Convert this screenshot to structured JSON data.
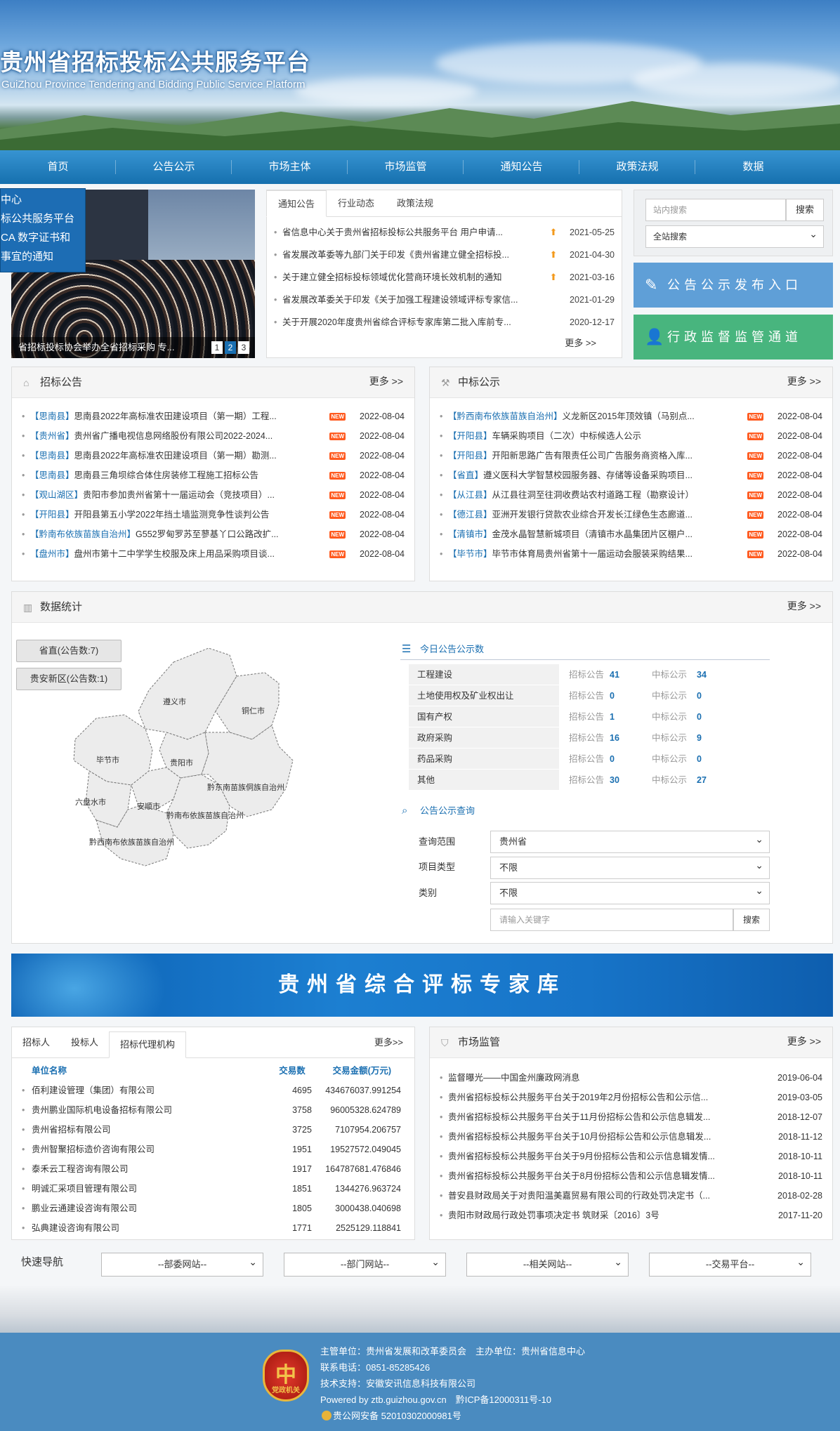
{
  "header": {
    "title": "贵州省招标投标公共服务平台",
    "subtitle": "GuiZhou Province Tendering and Bidding Public Service Platform"
  },
  "nav": [
    "首页",
    "公告公示",
    "市场主体",
    "市场监管",
    "通知公告",
    "政策法规",
    "数据"
  ],
  "float_notice": [
    "中心",
    "标公共服务平台",
    "CA 数字证书和",
    "事宜的通知"
  ],
  "banner": {
    "caption": "省招标投标协会举办全省招标采购 专...",
    "dots": [
      "1",
      "2",
      "3"
    ]
  },
  "notice": {
    "tabs": [
      "通知公告",
      "行业动态",
      "政策法规"
    ],
    "items": [
      {
        "t": "省信息中心关于贵州省招标投标公共服务平台 用户申请...",
        "d": "2021-05-25"
      },
      {
        "t": "省发展改革委等九部门关于印发《贵州省建立健全招标投...",
        "d": "2021-04-30"
      },
      {
        "t": "关于建立健全招标投标领域优化营商环境长效机制的通知",
        "d": "2021-03-16"
      },
      {
        "t": "省发展改革委关于印发《关于加强工程建设领域评标专家信...",
        "d": "2021-01-29"
      },
      {
        "t": "关于开展2020年度贵州省综合评标专家库第二批入库前专...",
        "d": "2020-12-17"
      }
    ],
    "more": "更多 >>"
  },
  "search": {
    "placeholder": "站内搜索",
    "button": "搜索",
    "scope": "全站搜索"
  },
  "buttons": {
    "publish": "公告公示发布入口",
    "supervise": "行政监督监管通道"
  },
  "bid": {
    "title": "招标公告",
    "more": "更多 >>",
    "new": "NEW",
    "items": [
      {
        "r": "【思南县】",
        "t": "思南县2022年高标准农田建设项目（第一期）工程...",
        "d": "2022-08-04"
      },
      {
        "r": "【贵州省】",
        "t": "贵州省广播电视信息网络股份有限公司2022-2024...",
        "d": "2022-08-04"
      },
      {
        "r": "【思南县】",
        "t": "思南县2022年高标准农田建设项目（第一期）勘测...",
        "d": "2022-08-04"
      },
      {
        "r": "【思南县】",
        "t": "思南县三角坝综合体住房装修工程施工招标公告",
        "d": "2022-08-04"
      },
      {
        "r": "【观山湖区】",
        "t": "贵阳市参加贵州省第十一届运动会（竞技项目）...",
        "d": "2022-08-04"
      },
      {
        "r": "【开阳县】",
        "t": "开阳县第五小学2022年挡土墙监测竞争性谈判公告",
        "d": "2022-08-04"
      },
      {
        "r": "【黔南布依族苗族自治州】",
        "t": "G552罗甸罗苏至蓼基丫口公路改扩...",
        "d": "2022-08-04"
      },
      {
        "r": "【盘州市】",
        "t": "盘州市第十二中学学生校服及床上用品采购项目谈...",
        "d": "2022-08-04"
      }
    ]
  },
  "win": {
    "title": "中标公示",
    "more": "更多 >>",
    "new": "NEW",
    "items": [
      {
        "r": "【黔西南布依族苗族自治州】",
        "t": "义龙新区2015年顶效镇（马别点...",
        "d": "2022-08-04"
      },
      {
        "r": "【开阳县】",
        "t": "车辆采购项目（二次）中标候选人公示",
        "d": "2022-08-04"
      },
      {
        "r": "【开阳县】",
        "t": "开阳新思路广告有限责任公司广告服务商资格入库...",
        "d": "2022-08-04"
      },
      {
        "r": "【省直】",
        "t": "遵义医科大学智慧校园服务器、存储等设备采购项目...",
        "d": "2022-08-04"
      },
      {
        "r": "【从江县】",
        "t": "从江县往洞至往洞收费站农村道路工程（勘察设计）",
        "d": "2022-08-04"
      },
      {
        "r": "【德江县】",
        "t": "亚洲开发银行贷款农业综合开发长江绿色生态廊道...",
        "d": "2022-08-04"
      },
      {
        "r": "【清镇市】",
        "t": "金茂水晶智慧新城项目（清镇市水晶集团片区棚户...",
        "d": "2022-08-04"
      },
      {
        "r": "【毕节市】",
        "t": "毕节市体育局贵州省第十一届运动会服装采购结果...",
        "d": "2022-08-04"
      }
    ]
  },
  "stats": {
    "title": "数据统计",
    "more": "更多 >>",
    "regions_btn": [
      "省直(公告数:7)",
      "贵安新区(公告数:1)"
    ],
    "map_labels": [
      "遵义市",
      "铜仁市",
      "毕节市",
      "贵阳市",
      "黔东南苗族侗族自治州",
      "六盘水市",
      "安顺市",
      "黔南布依族苗族自治州",
      "黔西南布依族苗族自治州"
    ],
    "today_title": "今日公告公示数",
    "label_bid": "招标公告",
    "label_win": "中标公示",
    "rows": [
      {
        "name": "工程建设",
        "bid": "41",
        "win": "34"
      },
      {
        "name": "土地使用权及矿业权出让",
        "bid": "0",
        "win": "0"
      },
      {
        "name": "国有产权",
        "bid": "1",
        "win": "0"
      },
      {
        "name": "政府采购",
        "bid": "16",
        "win": "9"
      },
      {
        "name": "药品采购",
        "bid": "0",
        "win": "0"
      },
      {
        "name": "其他",
        "bid": "30",
        "win": "27"
      }
    ],
    "query_title": "公告公示查询",
    "q_scope_label": "查询范围",
    "q_scope": "贵州省",
    "q_type_label": "项目类型",
    "q_type": "不限",
    "q_cat_label": "类别",
    "q_cat": "不限",
    "q_placeholder": "请输入关键字",
    "q_btn": "搜索"
  },
  "expert": "贵州省综合评标专家库",
  "agency": {
    "tabs": [
      "招标人",
      "投标人",
      "招标代理机构"
    ],
    "more": "更多>>",
    "headers": [
      "单位名称",
      "交易数",
      "交易金额(万元)"
    ],
    "rows": [
      {
        "n": "佰利建设管理（集团）有限公司",
        "c": "4695",
        "a": "434676037.991254"
      },
      {
        "n": "贵州鹏业国际机电设备招标有限公司",
        "c": "3758",
        "a": "96005328.624789"
      },
      {
        "n": "贵州省招标有限公司",
        "c": "3725",
        "a": "7107954.206757"
      },
      {
        "n": "贵州智聚招标造价咨询有限公司",
        "c": "1951",
        "a": "19527572.049045"
      },
      {
        "n": "泰禾云工程咨询有限公司",
        "c": "1917",
        "a": "164787681.476846"
      },
      {
        "n": "明诚汇采项目管理有限公司",
        "c": "1851",
        "a": "1344276.963724"
      },
      {
        "n": "鹏业云通建设咨询有限公司",
        "c": "1805",
        "a": "3000438.040698"
      },
      {
        "n": "弘典建设咨询有限公司",
        "c": "1771",
        "a": "2525129.118841"
      }
    ]
  },
  "market": {
    "title": "市场监管",
    "more": "更多 >>",
    "items": [
      {
        "t": "监督曝光——中国金州廉政网消息",
        "d": "2019-06-04"
      },
      {
        "t": "贵州省招标投标公共服务平台关于2019年2月份招标公告和公示信...",
        "d": "2019-03-05"
      },
      {
        "t": "贵州省招标投标公共服务平台关于11月份招标公告和公示信息辑发...",
        "d": "2018-12-07"
      },
      {
        "t": "贵州省招标投标公共服务平台关于10月份招标公告和公示信息辑发...",
        "d": "2018-11-12"
      },
      {
        "t": "贵州省招标投标公共服务平台关于9月份招标公告和公示信息辑发情...",
        "d": "2018-10-11"
      },
      {
        "t": "贵州省招标投标公共服务平台关于8月份招标公告和公示信息辑发情...",
        "d": "2018-10-11"
      },
      {
        "t": "普安县财政局关于对贵阳温美嘉贸易有限公司的行政处罚决定书（...",
        "d": "2018-02-28"
      },
      {
        "t": "贵阳市财政局行政处罚事项决定书 筑财采〔2016〕3号",
        "d": "2017-11-20"
      }
    ]
  },
  "quicknav": {
    "label": "快速导航",
    "selects": [
      "--部委网站--",
      "--部门网站--",
      "--相关网站--",
      "--交易平台--"
    ]
  },
  "footer": {
    "emblem_label": "党政机关",
    "lines": [
      "主管单位：贵州省发展和改革委员会　主办单位：贵州省信息中心",
      "联系电话：0851-85285426",
      "技术支持：安徽安讯信息科技有限公司",
      "Powered by ztb.guizhou.gov.cn　黔ICP备12000311号-10",
      "贵公网安备 52010302000981号"
    ]
  }
}
